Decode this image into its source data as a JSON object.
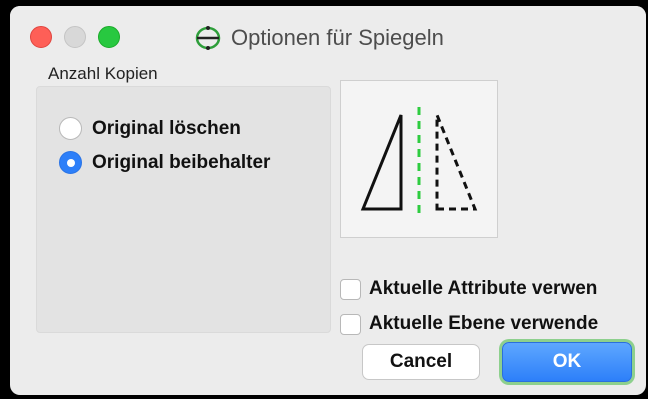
{
  "window": {
    "title": "Optionen für Spiegeln",
    "title_icon": "mirror-tool-icon"
  },
  "group": {
    "label": "Anzahl Kopien",
    "options": [
      {
        "label": "Original löschen",
        "checked": false
      },
      {
        "label": "Original beibehalter",
        "checked": true
      }
    ]
  },
  "preview": {
    "icon": "mirror-preview-icon",
    "axis_color": "#2ecc40"
  },
  "checkboxes": [
    {
      "label": "Aktuelle Attribute verwen",
      "checked": false
    },
    {
      "label": "Aktuelle Ebene verwende",
      "checked": false
    }
  ],
  "buttons": {
    "cancel": "Cancel",
    "ok": "OK"
  },
  "colors": {
    "accent": "#2d7ff9",
    "close": "#fe5f57",
    "maximize": "#28c840"
  }
}
